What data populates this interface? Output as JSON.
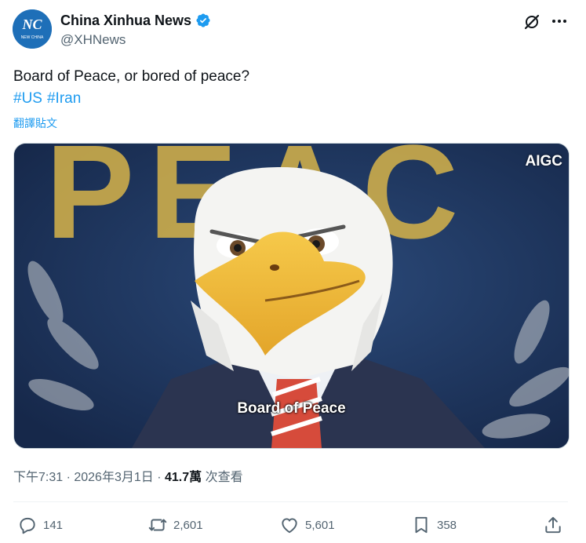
{
  "author": {
    "display_name": "China Xinhua News",
    "handle": "@XHNews",
    "avatar_text": "NEW CHINA"
  },
  "tweet": {
    "text": "Board of Peace, or bored of peace?",
    "hashtags": [
      "#US",
      "#Iran"
    ],
    "translate_label": "翻譯貼文"
  },
  "media": {
    "badge": "AIGC",
    "caption": "Board of Peace",
    "background_text": "PEAC"
  },
  "meta": {
    "timestamp": "下午7:31 · 2026年3月1日",
    "separator": " · ",
    "views_count": "41.7萬",
    "views_label": "次查看"
  },
  "actions": {
    "replies": "141",
    "retweets": "2,601",
    "likes": "5,601",
    "bookmarks": "358"
  },
  "icons": [
    "verified-badge-icon",
    "grok-icon",
    "more-icon",
    "reply-icon",
    "retweet-icon",
    "like-icon",
    "bookmark-icon",
    "share-icon"
  ],
  "colors": {
    "link": "#1d9bf0",
    "secondary_text": "#536471",
    "verified": "#1d9bf0"
  }
}
